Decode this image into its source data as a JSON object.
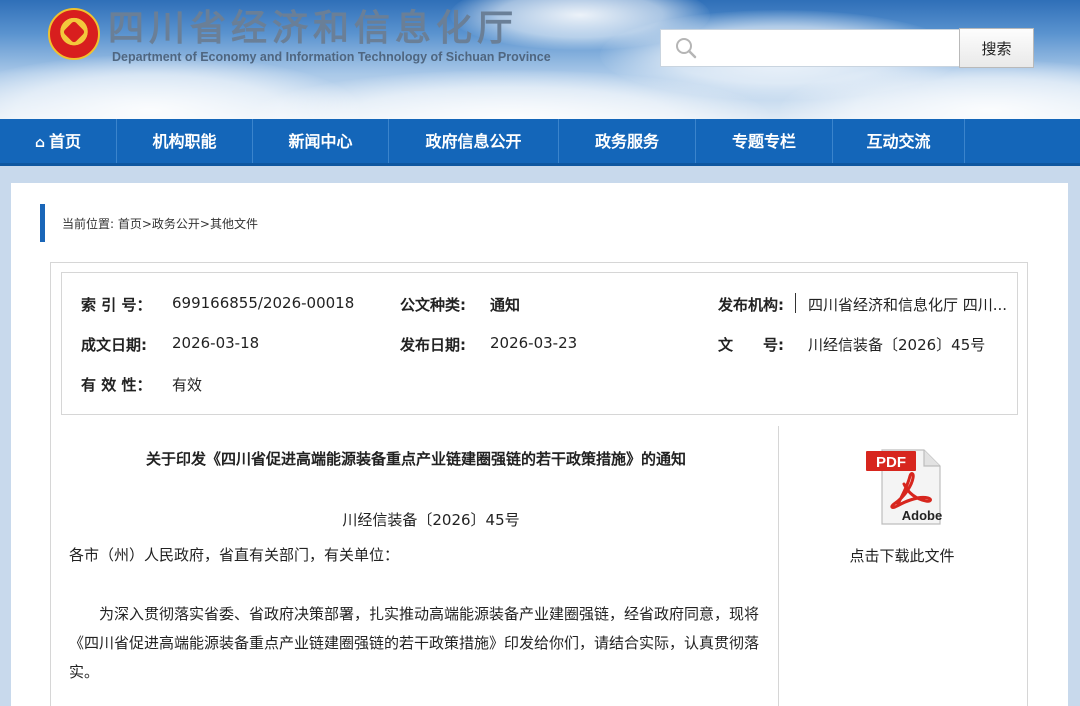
{
  "header": {
    "title": "四川省经济和信息化厅",
    "subtitle": "Department of Economy and Information Technology of Sichuan Province",
    "search_placeholder": "",
    "search_button": "搜索"
  },
  "nav": {
    "items": [
      {
        "label": "首页",
        "icon": "home-icon"
      },
      {
        "label": "机构职能"
      },
      {
        "label": "新闻中心"
      },
      {
        "label": "政府信息公开"
      },
      {
        "label": "政务服务"
      },
      {
        "label": "专题专栏"
      },
      {
        "label": "互动交流"
      }
    ]
  },
  "breadcrumb": "当前位置: 首页>政务公开>其他文件",
  "meta": {
    "index_label": "索 引 号：",
    "index_value": "699166855/2026-00018",
    "type_label": "公文种类:",
    "type_value": "通知",
    "agency_label": "发布机构:",
    "agency_value": "四川省经济和信息化厅 四川...",
    "created_label": "成文日期:",
    "created_value": "2026-03-18",
    "published_label": "发布日期:",
    "published_value": "2026-03-23",
    "docno_label": "文　　号:",
    "docno_value": "川经信装备〔2026〕45号",
    "validity_label": "有 效 性：",
    "validity_value": "有效"
  },
  "document": {
    "title": "关于印发《四川省促进高端能源装备重点产业链建圈强链的若干政策措施》的通知",
    "number": "川经信装备〔2026〕45号",
    "salutation": "各市（州）人民政府，省直有关部门，有关单位：",
    "paragraph": "为深入贯彻落实省委、省政府决策部署，扎实推动高端能源装备产业建圈强链，经省政府同意，现将《四川省促进高端能源装备重点产业链建圈强链的若干政策措施》印发给你们，请结合实际，认真贯彻落实。"
  },
  "attachment": {
    "pdf_label": "PDF",
    "brand_label": "Adobe",
    "download_label": "点击下载此文件"
  },
  "colors": {
    "nav_bg": "#1466b9",
    "accent": "#1a66b8",
    "pdf_red": "#d7261e"
  }
}
